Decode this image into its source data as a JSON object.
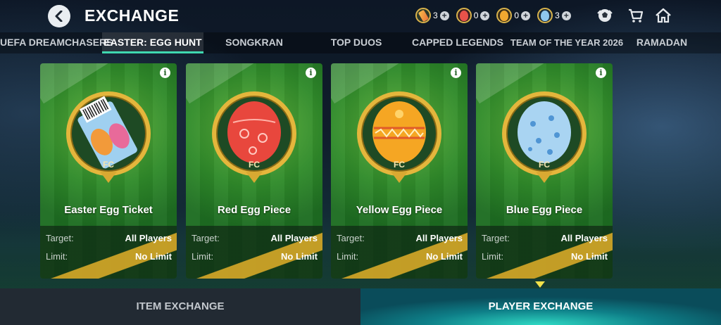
{
  "header": {
    "title": "EXCHANGE",
    "currencies": [
      {
        "name": "ticket",
        "count": "3",
        "color": "#e8a03a"
      },
      {
        "name": "red-egg",
        "count": "0",
        "color": "#e8524a"
      },
      {
        "name": "yellow-egg",
        "count": "0",
        "color": "#f0a830"
      },
      {
        "name": "blue-egg",
        "count": "3",
        "color": "#8ec7ee"
      }
    ],
    "icons": [
      "back-icon",
      "ball-icon",
      "cart-icon",
      "home-icon"
    ]
  },
  "tabs": [
    {
      "label": "UEFA DREAMCHASERS"
    },
    {
      "label": "EASTER: EGG HUNT",
      "active": true
    },
    {
      "label": "SONGKRAN"
    },
    {
      "label": "TOP DUOS"
    },
    {
      "label": "CAPPED LEGENDS"
    },
    {
      "label": "TEAM OF THE YEAR 2026"
    },
    {
      "label": "RAMADAN"
    }
  ],
  "cards": [
    {
      "title": "Easter Egg Ticket",
      "target_label": "Target:",
      "target": "All Players",
      "limit_label": "Limit:",
      "limit": "No Limit",
      "egg_color": "#f29a3a"
    },
    {
      "title": "Red Egg Piece",
      "target_label": "Target:",
      "target": "All Players",
      "limit_label": "Limit:",
      "limit": "No Limit",
      "egg_color": "#e8473d"
    },
    {
      "title": "Yellow Egg Piece",
      "target_label": "Target:",
      "target": "All Players",
      "limit_label": "Limit:",
      "limit": "No Limit",
      "egg_color": "#f5a623"
    },
    {
      "title": "Blue Egg Piece",
      "target_label": "Target:",
      "target": "All Players",
      "limit_label": "Limit:",
      "limit": "No Limit",
      "egg_color": "#a9d4f2"
    }
  ],
  "bottom_tabs": [
    {
      "label": "ITEM EXCHANGE"
    },
    {
      "label": "PLAYER EXCHANGE",
      "active": true
    }
  ],
  "colors": {
    "accent": "#3fd8b0",
    "gold": "#d6a828",
    "pitch": "#2f8a2a"
  }
}
